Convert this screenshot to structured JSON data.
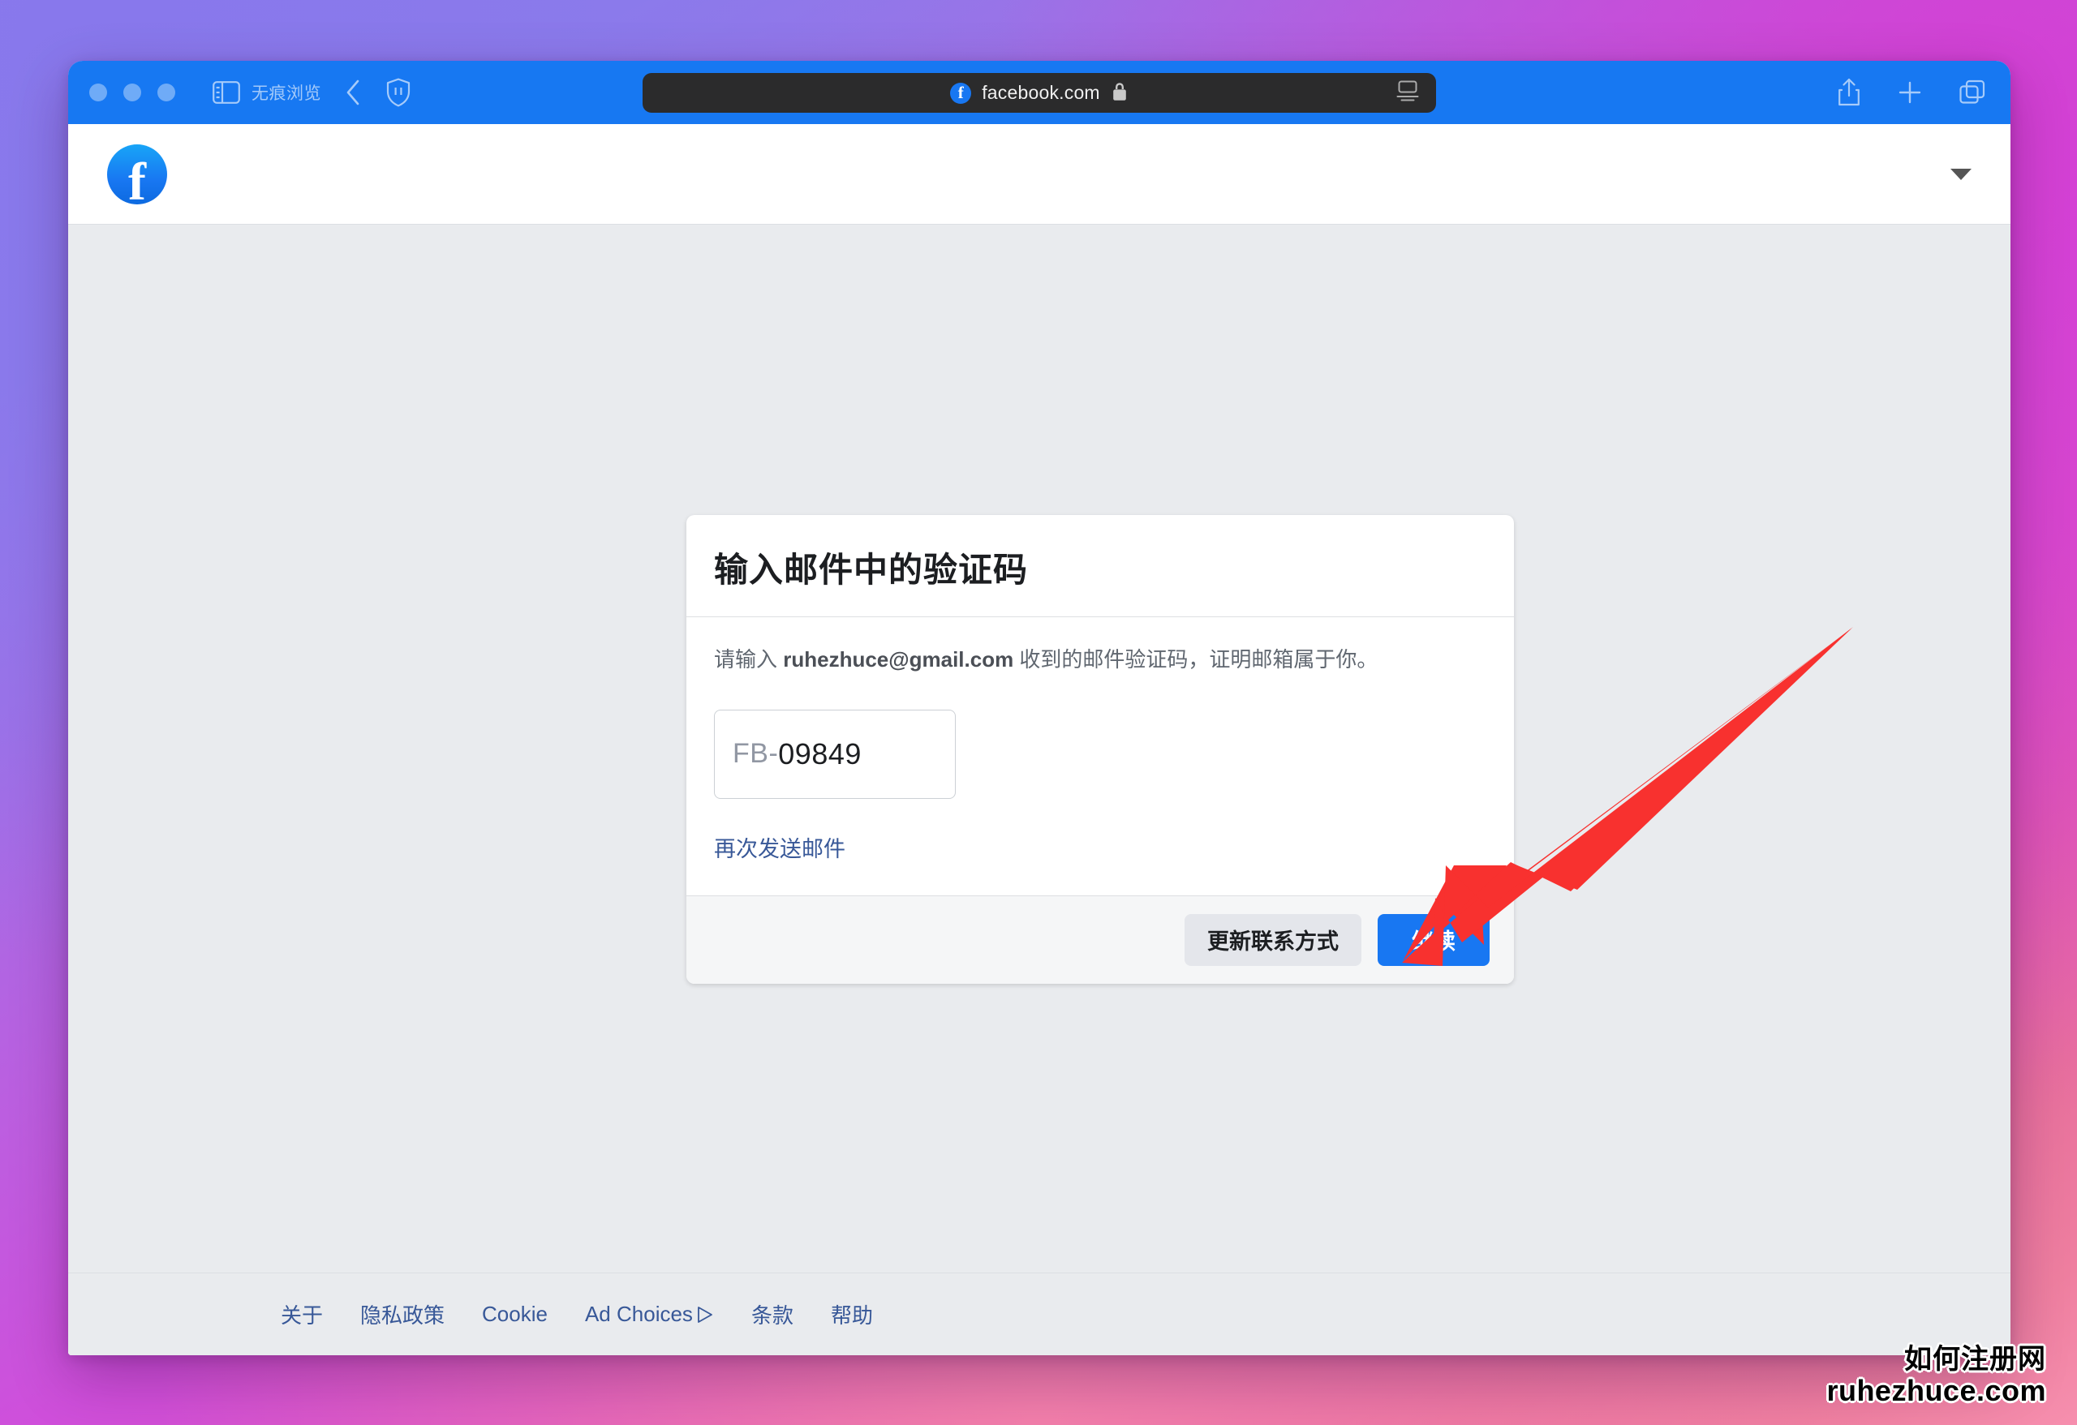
{
  "browser": {
    "private_label": "无痕浏览",
    "url": "facebook.com",
    "icons": {
      "sidebar": "sidebar-icon",
      "back": "back-chevron-icon",
      "shield": "privacy-shield-icon",
      "favicon": "facebook-favicon-icon",
      "lock": "lock-icon",
      "reader": "reader-mode-icon",
      "share": "share-icon",
      "new_tab": "plus-icon",
      "tabs": "tab-overview-icon"
    }
  },
  "page": {
    "logo_letter": "f",
    "header_caret": "chevron-down-icon"
  },
  "dialog": {
    "title": "输入邮件中的验证码",
    "desc_prefix": "请输入 ",
    "desc_email": "ruhezhuce@gmail.com",
    "desc_suffix": " 收到的邮件验证码，证明邮箱属于你。",
    "code_prefix": "FB-",
    "code_value": "09849",
    "code_placeholder": "FB-",
    "resend_label": "再次发送邮件",
    "secondary_button": "更新联系方式",
    "primary_button": "继续"
  },
  "footer": {
    "links": [
      {
        "label": "关于"
      },
      {
        "label": "隐私政策"
      },
      {
        "label": "Cookie"
      },
      {
        "label": "Ad Choices"
      },
      {
        "label": "条款"
      },
      {
        "label": "帮助"
      }
    ]
  },
  "annotation": {
    "arrow_color": "#f8312f",
    "arrow_name": "red-pointer-arrow"
  },
  "watermark": {
    "line1": "如何注册网",
    "line2": "ruhezhuce.com"
  },
  "colors": {
    "browser_chrome": "#1778f2",
    "facebook_blue": "#1877f2",
    "link_blue": "#385898",
    "page_bg": "#e9ebee"
  }
}
